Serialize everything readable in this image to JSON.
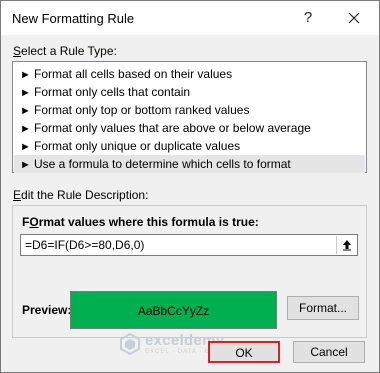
{
  "dialog": {
    "title": "New Formatting Rule",
    "help_glyph": "?",
    "close_glyph": "✕"
  },
  "rule_type": {
    "label_first": "S",
    "label_rest": "elect a Rule Type:",
    "items": [
      {
        "label": "Format all cells based on their values",
        "selected": false
      },
      {
        "label": "Format only cells that contain",
        "selected": false
      },
      {
        "label": "Format only top or bottom ranked values",
        "selected": false
      },
      {
        "label": "Format only values that are above or below average",
        "selected": false
      },
      {
        "label": "Format only unique or duplicate values",
        "selected": false
      },
      {
        "label": "Use a formula to determine which cells to format",
        "selected": true
      }
    ],
    "item_arrow": "►"
  },
  "description": {
    "label_first": "E",
    "label_rest": "dit the Rule Description:",
    "formula_label_first": "O",
    "formula_label_pre": "F",
    "formula_label_rest": "rmat values where this formula is true:",
    "formula_value": "=D6=IF(D6>=80,D6,0)",
    "collapse_glyph": "⬆",
    "preview_label": "Preview:",
    "preview_sample": "AaBbCcYyZz",
    "preview_color": "#00b050",
    "format_button": "Format..."
  },
  "footer": {
    "ok_button": "OK",
    "cancel_button": "Cancel"
  },
  "watermark": {
    "name": "exceldemy",
    "tagline": "EXCEL · DATA · BI"
  }
}
